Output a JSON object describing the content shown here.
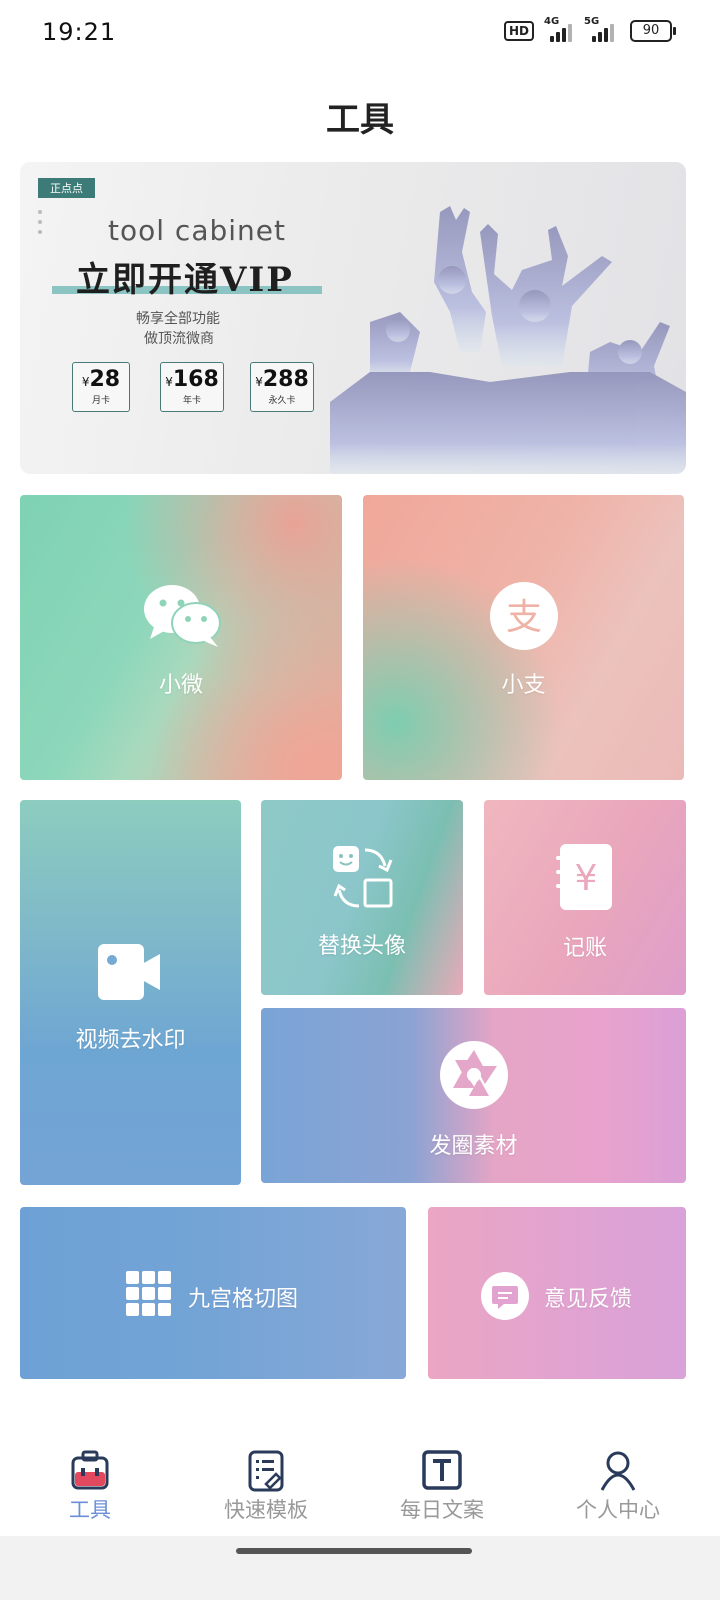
{
  "status_bar": {
    "time": "19:21",
    "hd": "HD",
    "net1": "4G",
    "net2": "5G",
    "battery": "90"
  },
  "page": {
    "title": "工具"
  },
  "banner": {
    "tag": "正点点",
    "english": "tool cabinet",
    "headline": "立即开通VIP",
    "sub1": "畅享全部功能",
    "sub2": "做顶流微商",
    "currency": "¥",
    "prices": [
      {
        "amount": "28",
        "label": "月卡"
      },
      {
        "amount": "168",
        "label": "年卡"
      },
      {
        "amount": "288",
        "label": "永久卡"
      }
    ]
  },
  "tools": {
    "weixin": "小微",
    "alipay": "小支",
    "video": "视频去水印",
    "avatar": "替换头像",
    "account": "记账",
    "moments": "发圈素材",
    "grid": "九宫格切图",
    "feedback": "意见反馈"
  },
  "nav": {
    "items": [
      {
        "label": "工具",
        "icon": "toolbox-icon",
        "active": true
      },
      {
        "label": "快速模板",
        "icon": "template-icon",
        "active": false
      },
      {
        "label": "每日文案",
        "icon": "text-icon",
        "active": false
      },
      {
        "label": "个人中心",
        "icon": "user-icon",
        "active": false
      }
    ]
  },
  "colors": {
    "accent": "#6b8fd6",
    "banner_tag": "#3c7b78"
  }
}
